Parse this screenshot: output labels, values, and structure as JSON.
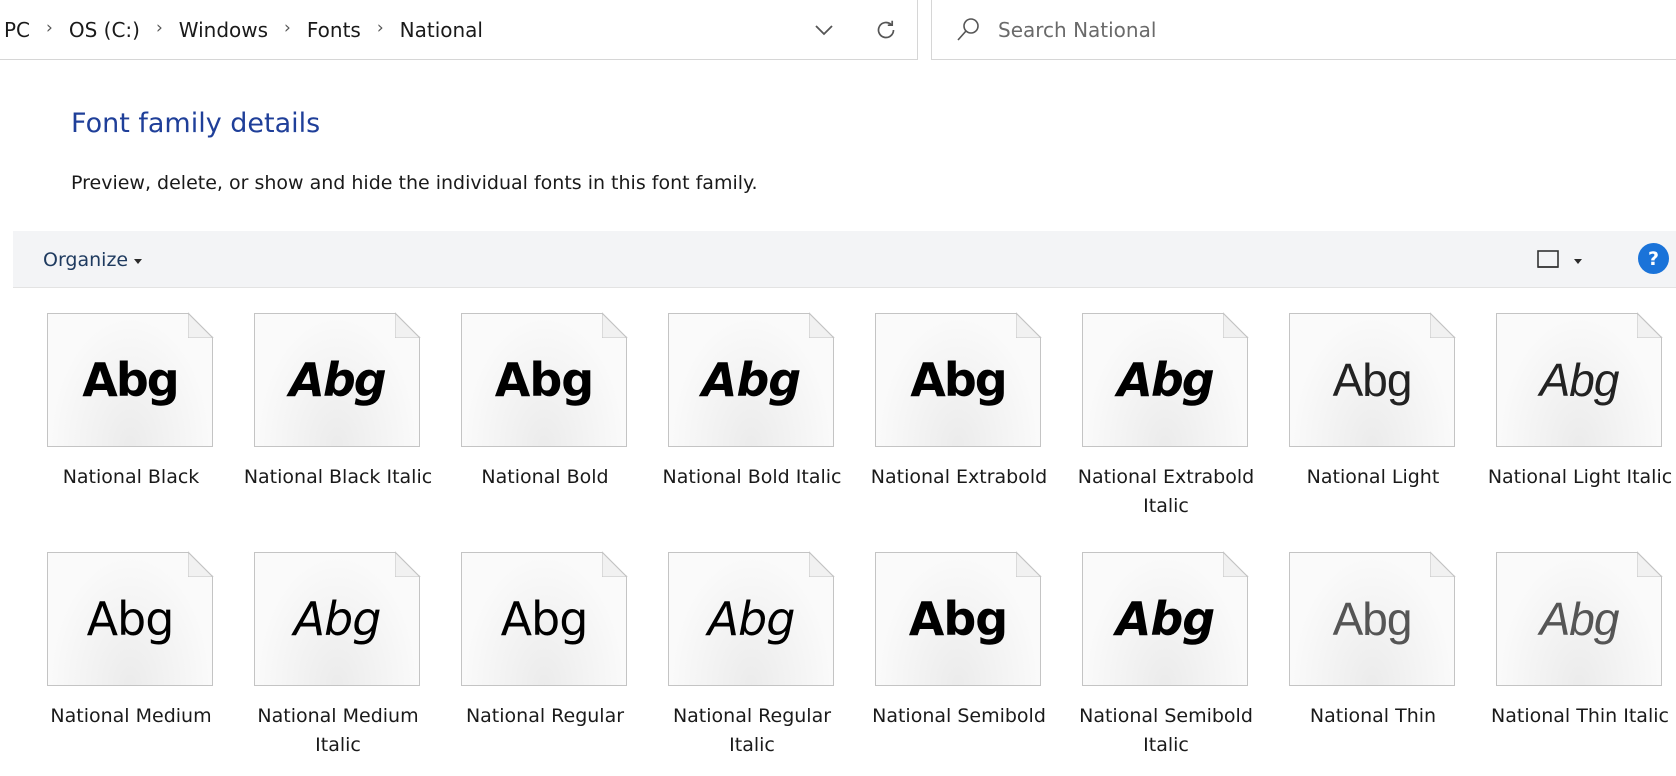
{
  "address_bar": {
    "crumbs": [
      "PC",
      "OS (C:)",
      "Windows",
      "Fonts",
      "National"
    ]
  },
  "search": {
    "placeholder": "Search National"
  },
  "header": {
    "title": "Font family details",
    "description": "Preview, delete, or show and hide the individual fonts in this font family."
  },
  "toolbar": {
    "organize_label": "Organize",
    "help_label": "?"
  },
  "icons": {
    "dropdown": "chevron-down-icon",
    "refresh": "refresh-icon",
    "search": "search-icon",
    "view": "view-layout-icon",
    "help": "help-icon"
  },
  "fonts": [
    {
      "label": "National Black",
      "sample": "Abg",
      "weight": 900,
      "italic": false
    },
    {
      "label": "National Black Italic",
      "sample": "Abg",
      "weight": 900,
      "italic": true
    },
    {
      "label": "National Bold",
      "sample": "Abg",
      "weight": 700,
      "italic": false
    },
    {
      "label": "National Bold Italic",
      "sample": "Abg",
      "weight": 700,
      "italic": true
    },
    {
      "label": "National Extrabold",
      "sample": "Abg",
      "weight": 800,
      "italic": false
    },
    {
      "label": "National Extrabold Italic",
      "sample": "Abg",
      "weight": 800,
      "italic": true
    },
    {
      "label": "National Light",
      "sample": "Abg",
      "weight": 300,
      "italic": false
    },
    {
      "label": "National Light Italic",
      "sample": "Abg",
      "weight": 300,
      "italic": true
    },
    {
      "label": "National Medium",
      "sample": "Abg",
      "weight": 500,
      "italic": false
    },
    {
      "label": "National Medium Italic",
      "sample": "Abg",
      "weight": 500,
      "italic": true
    },
    {
      "label": "National Regular",
      "sample": "Abg",
      "weight": 400,
      "italic": false
    },
    {
      "label": "National Regular Italic",
      "sample": "Abg",
      "weight": 400,
      "italic": true
    },
    {
      "label": "National Semibold",
      "sample": "Abg",
      "weight": 600,
      "italic": false
    },
    {
      "label": "National Semibold Italic",
      "sample": "Abg",
      "weight": 600,
      "italic": true
    },
    {
      "label": "National Thin",
      "sample": "Abg",
      "weight": 100,
      "italic": false
    },
    {
      "label": "National Thin Italic",
      "sample": "Abg",
      "weight": 100,
      "italic": true
    }
  ],
  "colors": {
    "title": "#1f3f99",
    "toolbar_bg": "#f3f4f6",
    "help": "#1a73d9"
  }
}
